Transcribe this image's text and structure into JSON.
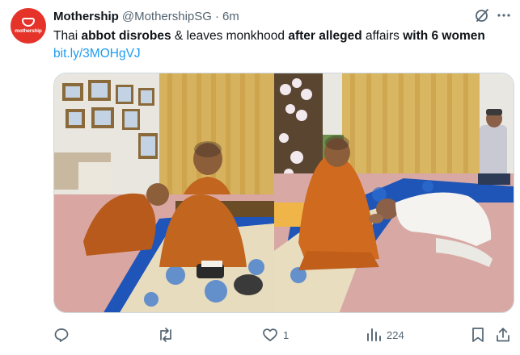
{
  "tweet": {
    "author_name": "Mothership",
    "handle": "@MothershipSG",
    "separator": "·",
    "time": "6m",
    "avatar_wordmark": "mothership",
    "text_segments": [
      {
        "text": "Thai ",
        "bold": false
      },
      {
        "text": "abbot disrobes",
        "bold": true
      },
      {
        "text": " & leaves monkhood ",
        "bold": false
      },
      {
        "text": "after alleged",
        "bold": true
      },
      {
        "text": " affairs ",
        "bold": false
      },
      {
        "text": "with 6 women",
        "bold": true
      },
      {
        "text": " ",
        "bold": false
      }
    ],
    "link_text": "bit.ly/3MOHgVJ",
    "images": [
      {
        "description_icon": "photo-monks-bowing"
      },
      {
        "description_icon": "photo-man-kneeling-before-monk"
      }
    ]
  },
  "actions": {
    "reply": {
      "icon": "reply-icon",
      "count": ""
    },
    "repost": {
      "icon": "repost-icon",
      "count": ""
    },
    "like": {
      "icon": "heart-icon",
      "count": "1"
    },
    "views": {
      "icon": "views-icon",
      "count": "224"
    },
    "bookmark": {
      "icon": "bookmark-icon"
    },
    "share": {
      "icon": "share-icon"
    }
  },
  "colors": {
    "brand_red": "#e5332a",
    "link_blue": "#1d9bf0",
    "muted_gray": "#536471",
    "text": "#0f1419"
  }
}
